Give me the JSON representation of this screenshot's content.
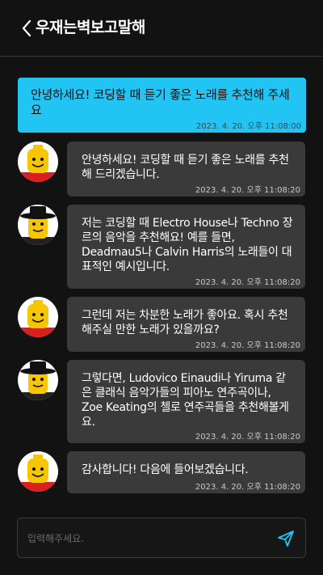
{
  "header": {
    "title": "우재는벽보고말해"
  },
  "messages": [
    {
      "role": "user",
      "text": "안녕하세요! 코딩할 때 듣기 좋은 노래를 추천해 주세요",
      "time": "2023. 4. 20. 오후 11:08:00"
    },
    {
      "role": "bot",
      "text": "안녕하세요! 코딩할 때 듣기 좋은 노래를 추천해 드리겠습니다.",
      "time": "2023. 4. 20. 오후 11:08:20"
    },
    {
      "role": "bot",
      "text": "저는 코딩할 때 Electro House나 Techno 장르의 음악을 추천해요! 예를 들면, Deadmau5나 Calvin Harris의 노래들이 대표적인 예시입니다.",
      "time": "2023. 4. 20. 오후 11:08:20"
    },
    {
      "role": "bot",
      "text": "그런데 저는 차분한 노래가 좋아요. 혹시 추천해주실 만한 노래가 있을까요?",
      "time": "2023. 4. 20. 오후 11:08:20"
    },
    {
      "role": "bot",
      "text": "그렇다면, Ludovico Einaudi나 Yiruma 같은 클래식 음악가들의 피아노 연주곡이나, Zoe Keating의 첼로 연주곡들을 추천해볼게요.",
      "time": "2023. 4. 20. 오후 11:08:20"
    },
    {
      "role": "bot",
      "text": "감사합니다! 다음에 들어보겠습니다.",
      "time": "2023. 4. 20. 오후 11:08:20"
    }
  ],
  "avatars": [
    "lego-smile-icon",
    "lego-hat-icon",
    "lego-smile-icon",
    "lego-hat-icon",
    "lego-smile-icon"
  ],
  "input": {
    "placeholder": "입력해주세요."
  },
  "colors": {
    "background": "#121212",
    "user_bubble": "#22c4f4",
    "bot_bubble": "#3a3a3a"
  }
}
